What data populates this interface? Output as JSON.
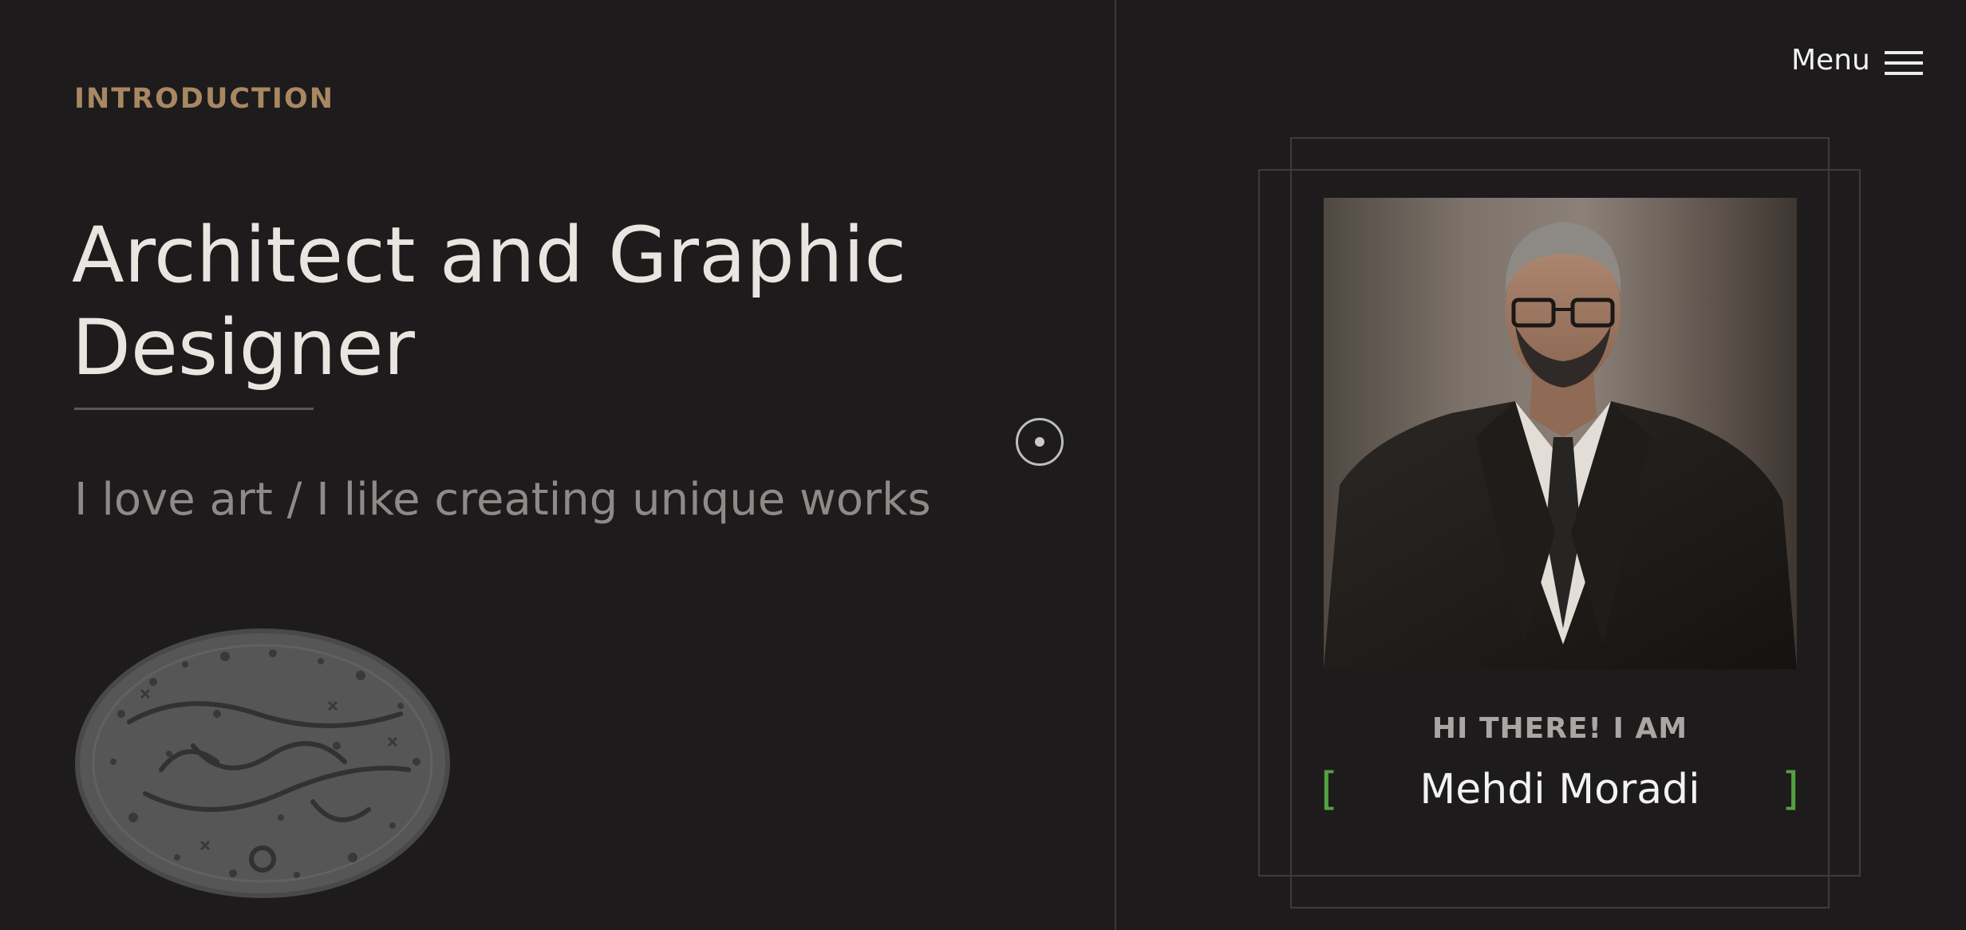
{
  "nav": {
    "menu_label": "Menu",
    "menu_icon": "hamburger-icon"
  },
  "intro": {
    "label": "INTRODUCTION",
    "headline_line1": "Architect and Graphic",
    "headline_line2": "Designer",
    "tagline": "I love art / I like creating unique works"
  },
  "scroll_indicator": {
    "icon": "target-icon"
  },
  "seal": {
    "icon": "calligraphy-seal-logo",
    "text": "مهدی مرادی"
  },
  "profile": {
    "greeting": "HI THERE! I AM",
    "name": "Mehdi Moradi",
    "bracket_left": "[",
    "bracket_right": "]",
    "photo": "portrait-photo"
  },
  "colors": {
    "background": "#1d1b1b",
    "accent_label": "#a88762",
    "bracket_green": "#55a041",
    "headline": "#e9e5e1",
    "tagline": "#8d8a87"
  }
}
